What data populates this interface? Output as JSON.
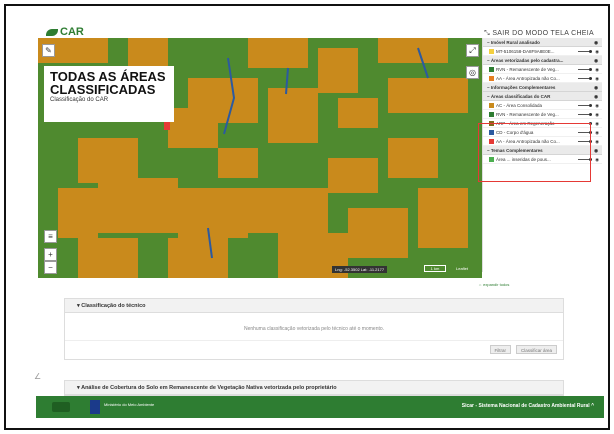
{
  "header": {
    "logo_text": "CAR",
    "exit_fullscreen": "SAIR DO MODO TELA CHEIA"
  },
  "map": {
    "title_line1": "TODAS AS ÁREAS",
    "title_line2": "CLASSIFICADAS",
    "subtitle": "Classificação do CAR",
    "coords": "Lng: -52.3502 Lat: -11.2177",
    "scale": "1 km",
    "attribution": "Leaflet",
    "colors": {
      "forest": "#4f8a2f",
      "cleared": "#c98a1c",
      "water": "#2c5aa0",
      "app": "#e53935"
    }
  },
  "panel": {
    "sections": [
      {
        "header": "Imóvel Rural analisado",
        "items": [
          {
            "label": "MT-5106158-DA8F9A8E0E...",
            "color": "#f4d03f"
          }
        ]
      },
      {
        "header": "Áreas vetorizadas pelo cadastra...",
        "items": [
          {
            "label": "RVN - Remanescente de Veg...",
            "color": "#2e7d32"
          },
          {
            "label": "AA - Área Antropizada não Co...",
            "color": "#e67e22"
          }
        ]
      },
      {
        "header": "Informações Complementares",
        "items": []
      },
      {
        "header": "Áreas classificadas do CAR",
        "items": [
          {
            "label": "AC - Área Consolidada",
            "color": "#c98a1c"
          },
          {
            "label": "RVN - Remanescente de Veg...",
            "color": "#2e7d32"
          },
          {
            "label": "ARP - Área em Regeneração",
            "color": "#7f6a1c"
          },
          {
            "label": "CD - Corpo d'água",
            "color": "#2c5aa0"
          },
          {
            "label": "AA - Área Antropizada não Co...",
            "color": "#e53935"
          }
        ]
      },
      {
        "header": "Temas Complementares",
        "items": [
          {
            "label": "Área ... inseridas de pous...",
            "color": "#4caf50"
          }
        ]
      }
    ],
    "expand_label": "expandir todos"
  },
  "sections": [
    {
      "header": "Classificação do técnico",
      "message": "Nenhuma classificação vetorizada pelo técnico até o momento.",
      "buttons": [
        "Filtrar",
        "Classificar área"
      ]
    },
    {
      "header": "Análise de Cobertura do Solo em Remanescente de Vegetação Nativa vetorizada pelo proprietário"
    }
  ],
  "footer": {
    "right_text": "Sicar - Sistema Nacional de Cadastro Ambiental Rural",
    "ministry": "Ministério do Meio Ambiente"
  }
}
